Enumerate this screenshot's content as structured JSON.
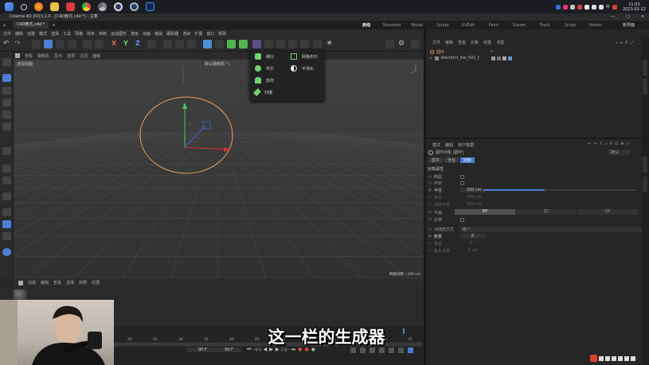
{
  "taskbar": {
    "window_title": "Cinema 4D 2023.1.0 - [C4D教式.c4d *] - 主要",
    "clock_time": "11:03",
    "clock_date": "2023-02-22",
    "lang": "中",
    "icons": [
      "windows-start-icon",
      "search-icon",
      "firefox-icon",
      "file-explorer-icon",
      "red-app-icon",
      "chrome-icon",
      "chrome-dev-icon",
      "cinema4d-icon",
      "cinema4d-icon-2",
      "photoshop-icon"
    ]
  },
  "tabbar": {
    "doc_tab": "C4D教式.c4d *",
    "layouts": [
      "启动",
      "Standard",
      "Model",
      "Sculpt",
      "UVEdit",
      "Paint",
      "Groom",
      "Track",
      "Script",
      "Nodes"
    ],
    "active_layout": "启动",
    "new_layout": "新界面"
  },
  "menubar": [
    "文件",
    "编辑",
    "创建",
    "模式",
    "选择",
    "工具",
    "网格",
    "样条",
    "体积",
    "运动图形",
    "角色",
    "动画",
    "模拟",
    "跟踪器",
    "渲染",
    "扩展",
    "窗口",
    "帮助"
  ],
  "viewport": {
    "menu": [
      "查看",
      "摄像机",
      "显示",
      "选项",
      "过滤",
      "面板"
    ],
    "label": "透视视图",
    "camera": "默认摄像机 °∘",
    "grid_spacing": "网格间距 : 100 cm"
  },
  "generator_popup": {
    "items": [
      {
        "label": "细分",
        "color": "#6fd36f"
      },
      {
        "label": "布尔",
        "color": "#6fd36f"
      },
      {
        "label": "放样",
        "color": "#6fd36f"
      },
      {
        "label": "扫描",
        "color": "#6fd36f"
      },
      {
        "label": "网格布尔",
        "color": "#6fd36f"
      },
      {
        "label": "平滑化",
        "color": "#dddddd"
      }
    ]
  },
  "object_manager": {
    "menu": [
      "文件",
      "编辑",
      "查看",
      "对象",
      "标签",
      "书签"
    ],
    "objects": [
      {
        "name": "圆环",
        "color": "#e0a040"
      },
      {
        "name": "desireful_me_001_t",
        "color": "#bbbbbb"
      }
    ]
  },
  "attributes": {
    "menu": [
      "模式",
      "编辑",
      "用户数据"
    ],
    "object_title": "圆环对象 [圆环]",
    "preset": "默认",
    "tabs": [
      "基本",
      "坐标",
      "对象"
    ],
    "active_tab": "对象",
    "section": "对象属性",
    "props": [
      {
        "label": "椭圆",
        "value": ""
      },
      {
        "label": "环状",
        "value": ""
      },
      {
        "label": "半径",
        "value": "200 cm"
      },
      {
        "label": "半径",
        "value": "200 cm"
      },
      {
        "label": "内部半径",
        "value": "100 cm"
      },
      {
        "label": "平面",
        "value": ""
      },
      {
        "label": "反转",
        "value": ""
      },
      {
        "label": "点插值方式",
        "value": "统一"
      },
      {
        "label": "数量",
        "value": "8"
      },
      {
        "label": "角度",
        "value": "5 °"
      },
      {
        "label": "最大长度",
        "value": "5 cm"
      }
    ],
    "plane_options": [
      "XY",
      "ZY",
      "XZ"
    ],
    "plane_selected": "XY",
    "radius_fraction": 0.4
  },
  "timeline": {
    "menu": [
      "创建",
      "编辑",
      "查看",
      "选择",
      "材质",
      "纹理"
    ],
    "ruler": [
      "20",
      "25",
      "30",
      "35",
      "40",
      "45",
      "50",
      "55",
      "60",
      "65",
      "70",
      "75",
      "80",
      "85",
      "90"
    ],
    "frame_start": "90 F",
    "frame_current": "90 F"
  },
  "subtitle": "这一栏的生成器",
  "colors": {
    "accent": "#4a7fd8",
    "circle": "#e0a060",
    "axis_x": "#d63232",
    "axis_y": "#3fcf5a",
    "axis_z": "#3a6fe0"
  }
}
